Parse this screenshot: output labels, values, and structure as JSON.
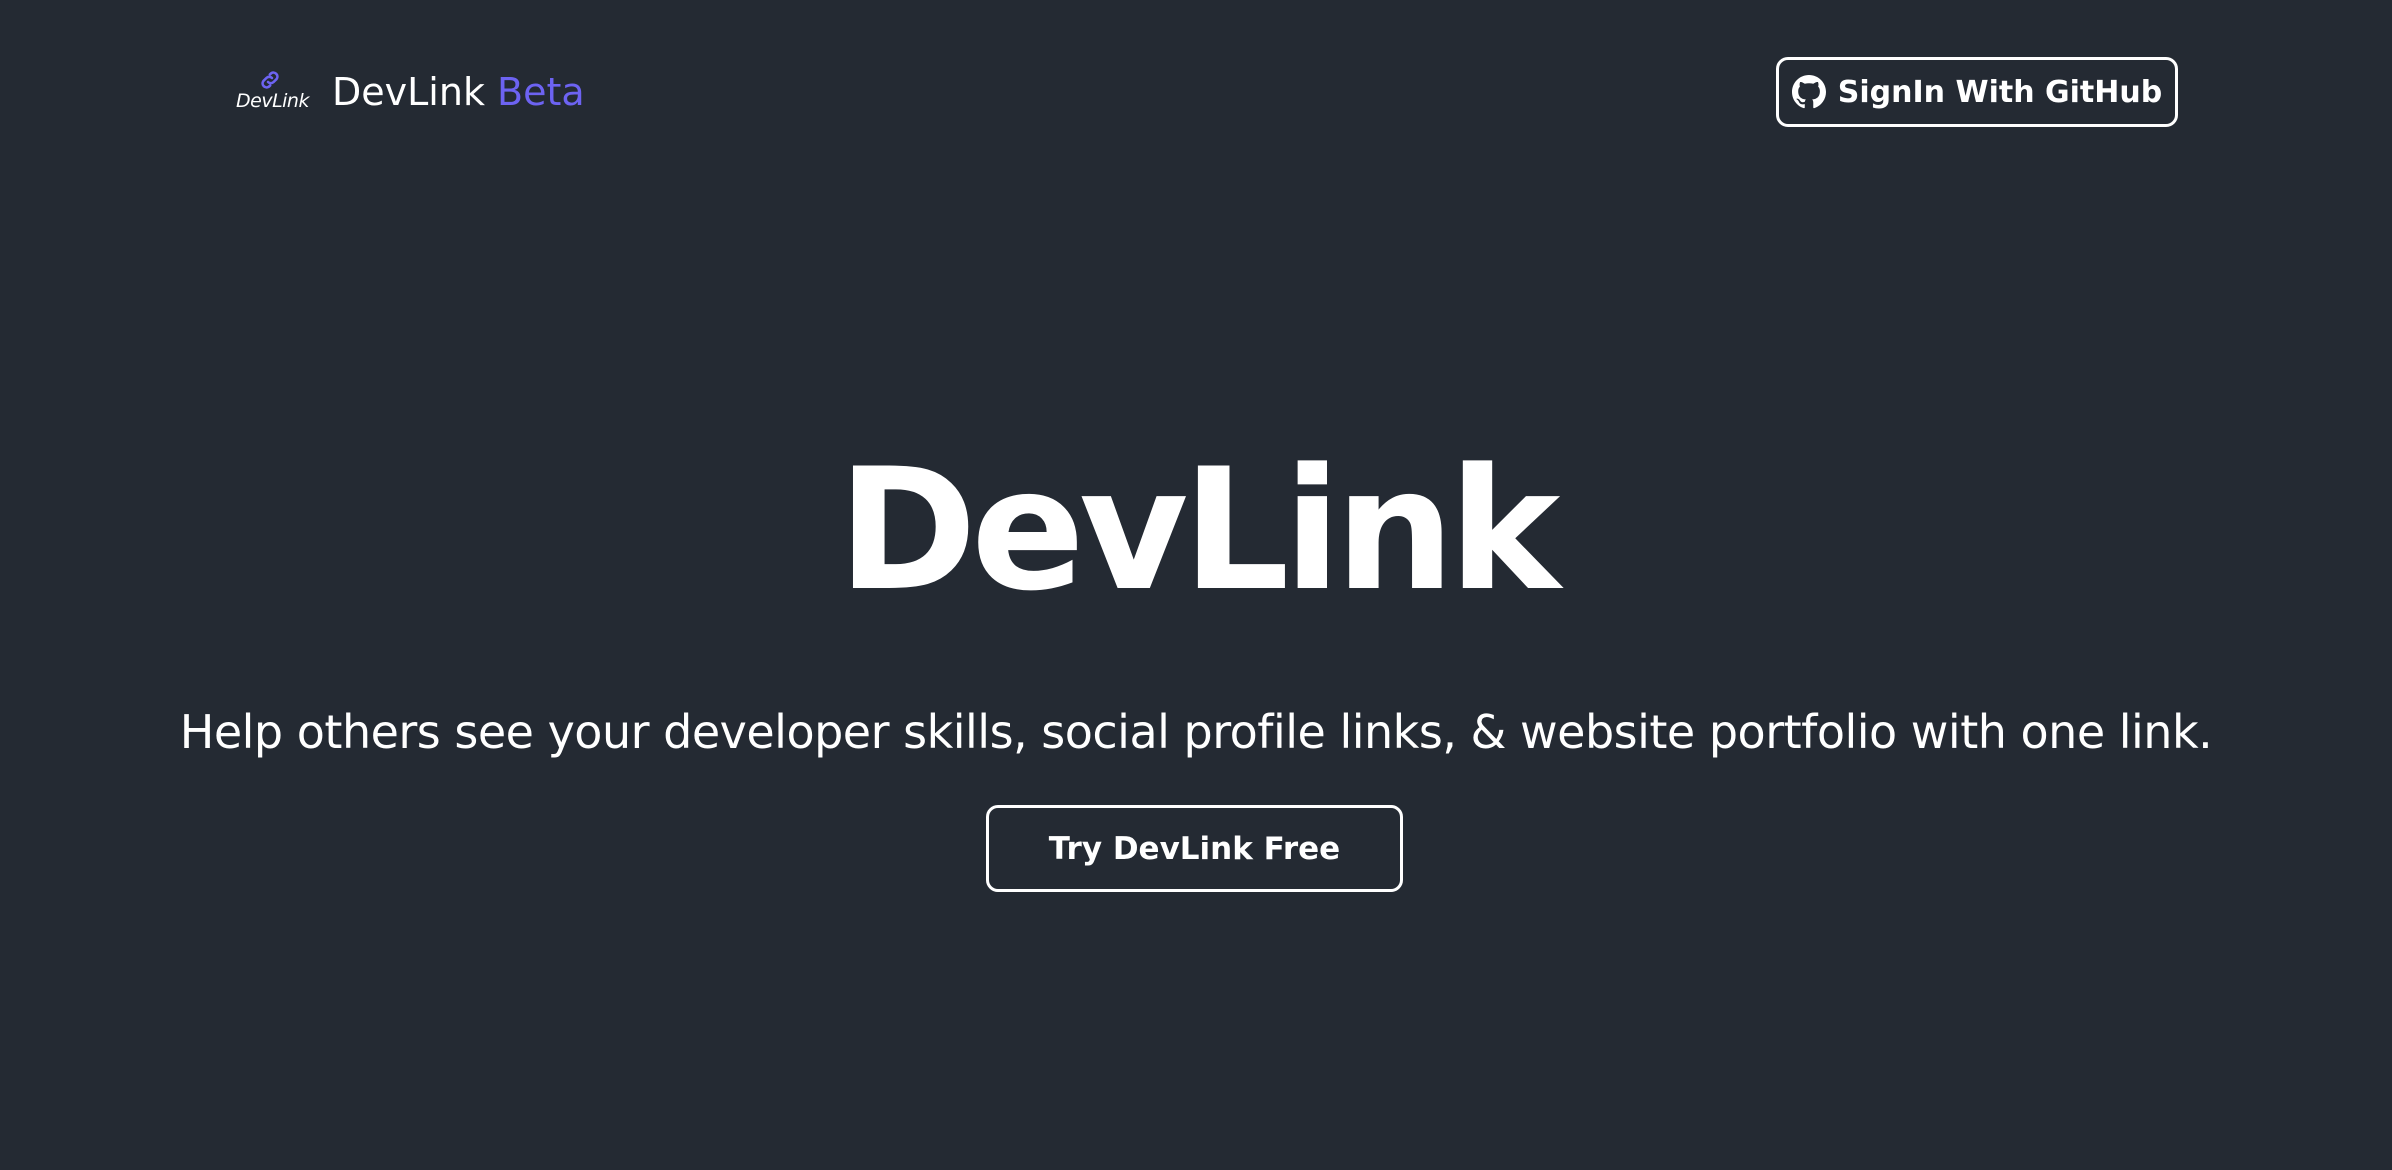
{
  "header": {
    "logo_mark_text": "DevLink",
    "brand_name": "DevLink",
    "brand_badge": "Beta",
    "signin_label": "SignIn With GitHub"
  },
  "hero": {
    "title": "DevLink",
    "tagline": "Help others see your developer skills, social profile links, & website portfolio with one link.",
    "cta_label": "Try DevLink Free"
  },
  "colors": {
    "background": "#242a33",
    "accent": "#6d63f2",
    "text": "#ffffff"
  },
  "icons": {
    "logo": "link-icon",
    "signin": "github-icon"
  }
}
